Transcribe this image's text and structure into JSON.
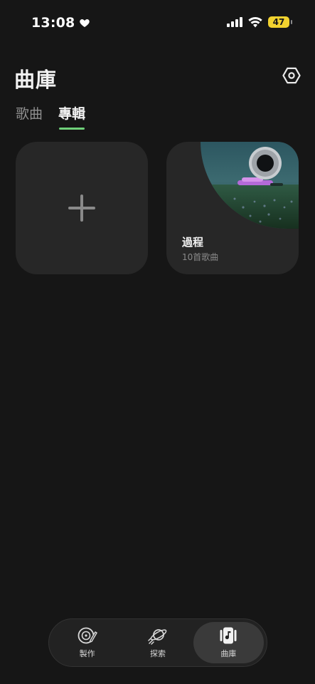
{
  "status_bar": {
    "time": "13:08",
    "battery_level": "47",
    "battery_color": "#f2d22f",
    "icons": [
      "heart-icon",
      "cellular-signal-icon",
      "wifi-icon",
      "battery-icon"
    ]
  },
  "header": {
    "title": "曲庫",
    "settings_icon": "settings-hexagon-icon"
  },
  "tabs": [
    {
      "label": "歌曲",
      "active": false
    },
    {
      "label": "專輯",
      "active": true
    }
  ],
  "accent_color": "#6fd07a",
  "albums": {
    "new_album_icon": "plus-icon",
    "items": [
      {
        "title": "過程",
        "subtitle": "10首歌曲"
      }
    ]
  },
  "bottom_nav": {
    "items": [
      {
        "label": "製作",
        "icon": "vinyl-pen-icon",
        "active": false
      },
      {
        "label": "探索",
        "icon": "rocket-planet-icon",
        "active": false
      },
      {
        "label": "曲庫",
        "icon": "music-library-icon",
        "active": true
      }
    ]
  }
}
